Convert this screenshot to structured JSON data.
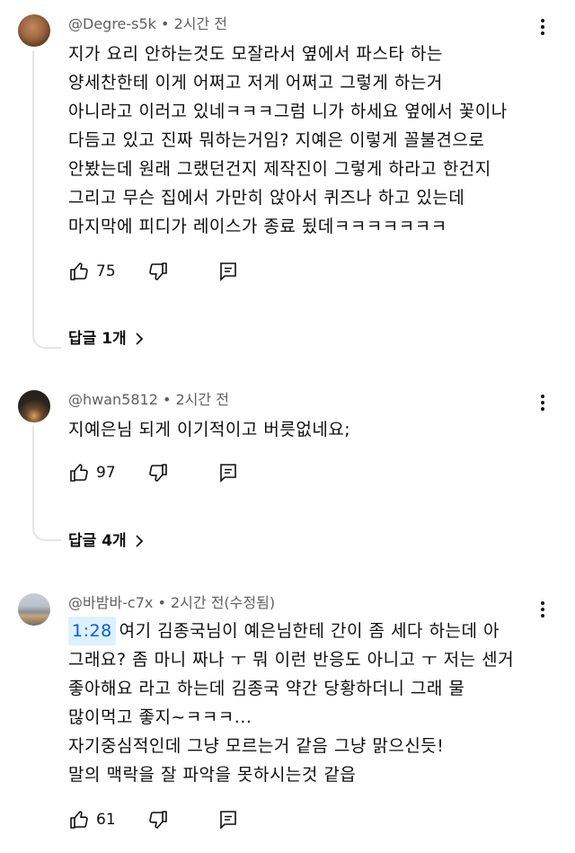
{
  "comments": [
    {
      "author": "@Degre-s5k",
      "meta_suffix": " • 2시간 전",
      "lines": [
        "지가 요리 안하는것도 모잘라서 옆에서 파스타 하는",
        "양세찬한테 이게 어쩌고 저게 어쩌고 그렇게 하는거",
        "아니라고 이러고 있네ㅋㅋㅋ그럼 니가 하세요 옆에서 꽃이나",
        "다듬고 있고 진짜 뭐하는거임? 지예은 이렇게 꼴불견으로",
        "안봤는데 원래 그랬던건지 제작진이 그렇게 하라고 한건지",
        "그리고 무슨 집에서 가만히 앉아서 퀴즈나 하고 있는데",
        "마지막에 피디가 레이스가 종료 됬데ㅋㅋㅋㅋㅋㅋㅋ"
      ],
      "likes": "75",
      "replies_label": "답글 1개"
    },
    {
      "author": "@hwan5812",
      "meta_suffix": " • 2시간 전",
      "lines": [
        "지예은님 되게 이기적이고 버릇없네요;"
      ],
      "likes": "97",
      "replies_label": "답글 4개"
    },
    {
      "author": "@바밤바-c7x",
      "meta_suffix": " • 2시간 전(수정됨)",
      "timestamp_link": "1:28",
      "first_line_rest": "여기 김종국님이 예은님한테 간이 좀 세다 하는데 아",
      "lines": [
        "그래요? 좀 마니 짜나 ㅜ 뭐 이런 반응도 아니고 ㅜ 저는 센거",
        "좋아해요 라고 하는데 김종국 약간 당황하더니 그래 물",
        "많이먹고 좋지~ㅋㅋㅋ...",
        "자기중심적인데 그냥 모르는거 같음 그냥 맑으신듯!",
        "말의 맥락을 잘 파악을 못하시는것 같읍"
      ],
      "likes": "61"
    }
  ]
}
